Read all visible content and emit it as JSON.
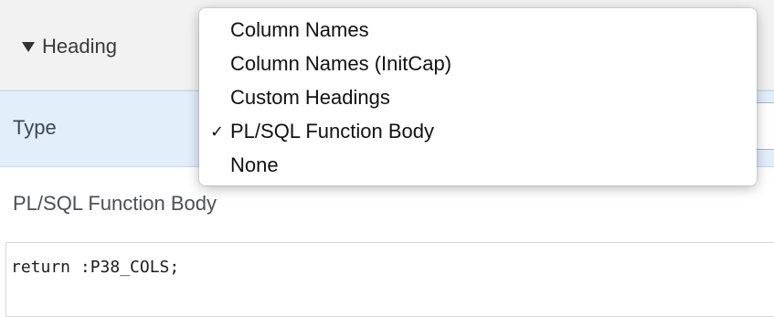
{
  "heading_section": {
    "title": "Heading",
    "collapse_icon": "triangle-down-icon",
    "expanded": true
  },
  "type_field": {
    "label": "Type",
    "selected_value": "PL/SQL Function Body",
    "options": [
      {
        "label": "Column Names",
        "selected": false
      },
      {
        "label": "Column Names (InitCap)",
        "selected": false
      },
      {
        "label": "Custom Headings",
        "selected": false
      },
      {
        "label": "PL/SQL Function Body",
        "selected": true,
        "check_mark": "✓"
      },
      {
        "label": "None",
        "selected": false
      }
    ]
  },
  "function_body_field": {
    "label": "PL/SQL Function Body",
    "code": "return :P38_COLS;"
  },
  "colors": {
    "section_header_bg": "#f2f2f2",
    "type_row_bg": "#e3eefb",
    "menu_bg": "#ffffff"
  }
}
